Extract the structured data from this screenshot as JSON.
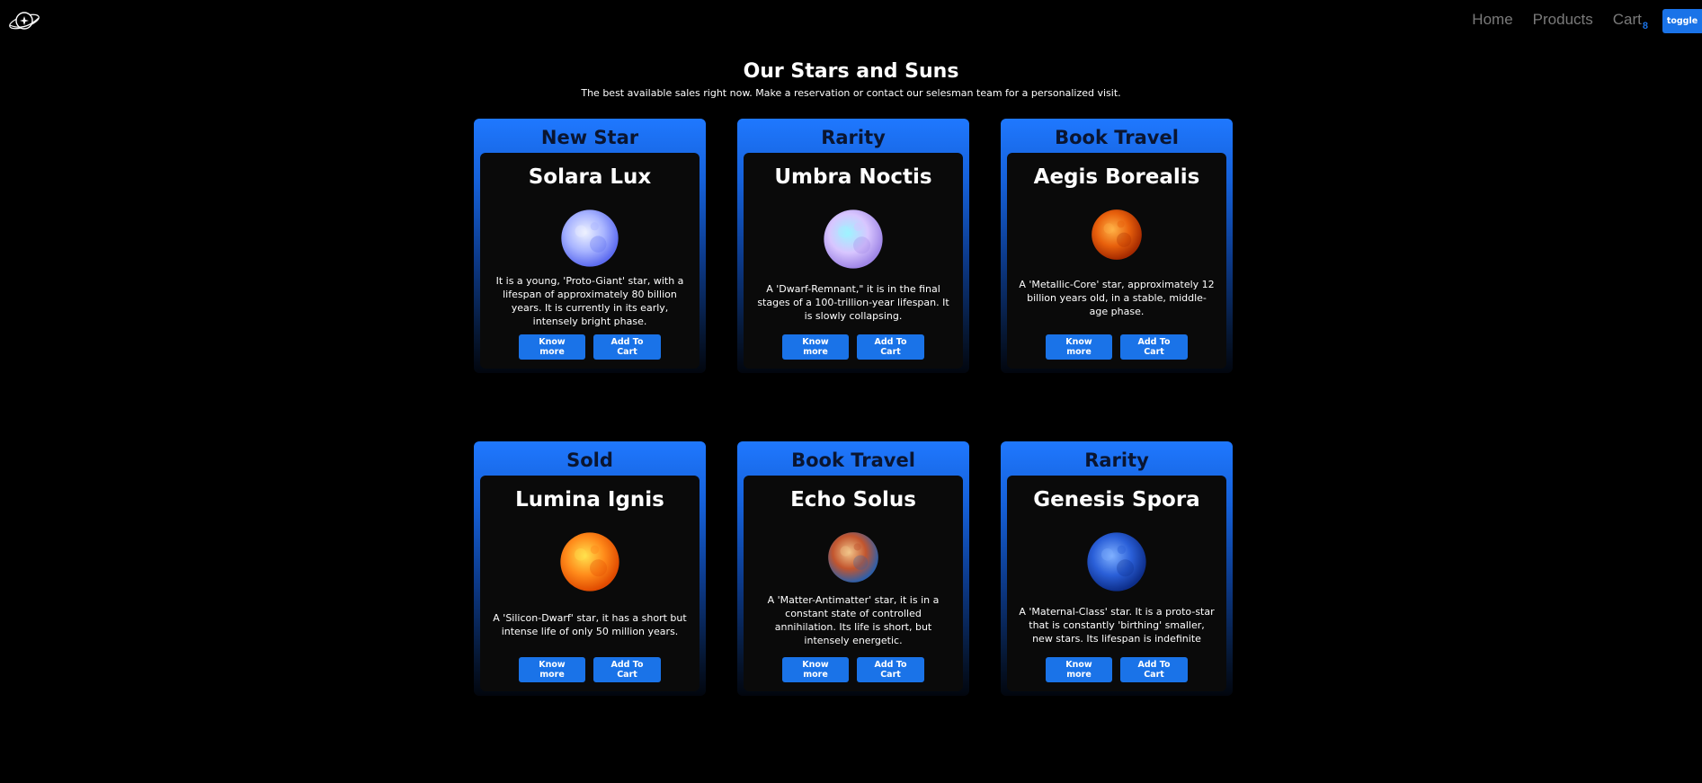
{
  "nav": {
    "logo_icon": "planet-star-icon",
    "links": [
      "Home",
      "Products",
      "Cart"
    ],
    "cart_count": "8",
    "toggle_label": "toggle"
  },
  "hero": {
    "title": "Our Stars and Suns",
    "subtitle": "The best available sales right now. Make a reservation or contact our selesman team for a personalized visit."
  },
  "cards": [
    {
      "tag": "New Star",
      "name": "Solara Lux",
      "description": "It is a young, 'Proto-Giant' star, with a lifespan of approximately 80 billion years. It is currently in its early, intensely bright phase.",
      "know_more": "Know more",
      "add_to_cart": "Add To Cart",
      "colors": [
        "#eef2ff",
        "#a8b4ff",
        "#5d6cf0"
      ]
    },
    {
      "tag": "Rarity",
      "name": "Umbra Noctis",
      "description": "A 'Dwarf-Remnant,\" it is in the final stages of a 100-trillion-year lifespan. It is slowly collapsing.",
      "know_more": "Know more",
      "add_to_cart": "Add To Cart",
      "colors": [
        "#9ef3ff",
        "#d8c6ff",
        "#9f86e6"
      ]
    },
    {
      "tag": "Book Travel",
      "name": "Aegis Borealis",
      "description": "A 'Metallic-Core' star, approximately 12 billion years old, in a stable, middle-age phase.",
      "know_more": "Know more",
      "add_to_cart": "Add To Cart",
      "colors": [
        "#ffb347",
        "#e8600c",
        "#a52a00"
      ]
    },
    {
      "tag": "Sold",
      "name": "Lumina Ignis",
      "description": "A 'Silicon-Dwarf' star, it has a short but intense life of only 50 million years.",
      "know_more": "Know more",
      "add_to_cart": "Add To Cart",
      "colors": [
        "#ffe14d",
        "#ff8a1a",
        "#e04a00"
      ]
    },
    {
      "tag": "Book Travel",
      "name": "Echo Solus",
      "description": "A 'Matter-Antimatter' star, it is in a constant state of controlled annihilation. Its life is short, but intensely energetic.",
      "know_more": "Know more",
      "add_to_cart": "Add To Cart",
      "colors": [
        "#f2c58a",
        "#c2552e",
        "#2f5fa8"
      ]
    },
    {
      "tag": "Rarity",
      "name": "Genesis Spora",
      "description": "A 'Maternal-Class' star. It is a proto-star that is constantly 'birthing' smaller, new stars. Its lifespan is indefinite",
      "know_more": "Know more",
      "add_to_cart": "Add To Cart",
      "colors": [
        "#7fb0ff",
        "#2a5fd8",
        "#0d2e8a"
      ]
    }
  ]
}
